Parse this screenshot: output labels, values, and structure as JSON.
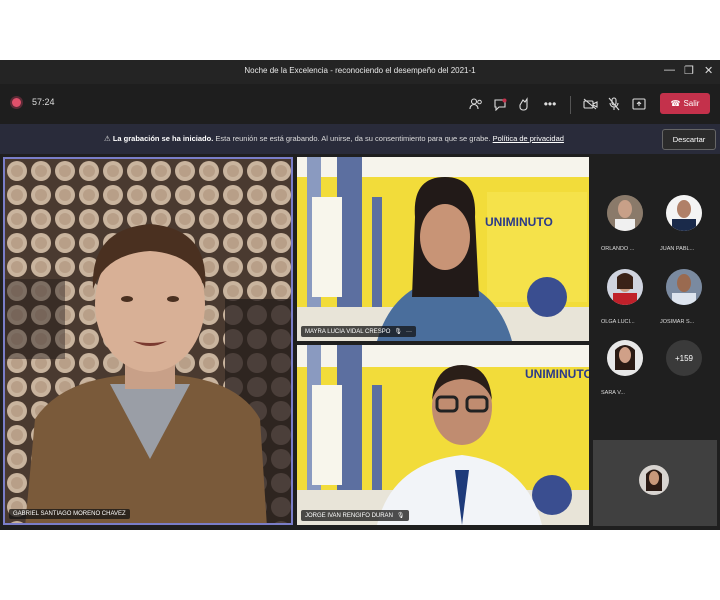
{
  "window": {
    "title": "Noche de la Excelencia - reconociendo el desempeño del 2021-1",
    "controls": {
      "minimize": "—",
      "restore": "❐",
      "close": "✕"
    }
  },
  "toolbar": {
    "timer": "57:24",
    "icons": [
      "people-icon",
      "chat-icon",
      "reactions-icon",
      "more-icon",
      "camera-off-icon",
      "mic-off-icon",
      "share-icon"
    ],
    "leave_label": "Salir"
  },
  "banner": {
    "bold": "La grabación se ha iniciado.",
    "text": "Esta reunión se está grabando. Al unirse, da su consentimiento para que se grabe.",
    "link": "Política de privacidad",
    "dismiss": "Descartar"
  },
  "tiles": [
    {
      "name": "GABRIEL SANTIAGO MORENO CHAVEZ"
    },
    {
      "name": "MAYRA LUCIA VIDAL CRESPO"
    },
    {
      "name": "JORGE IVAN RENGIFO DURAN"
    }
  ],
  "uniminuto_logo": "UNIMINUTO",
  "participants": [
    {
      "label": "ORLANDO ..."
    },
    {
      "label": "JUAN PABL..."
    },
    {
      "label": "OLGA LUCI..."
    },
    {
      "label": "JOSIMAR S..."
    },
    {
      "label": "SARA V..."
    }
  ],
  "more_participants": "+159",
  "colors": {
    "accent": "#6264a7",
    "leave": "#c4314b",
    "banner": "#292b3a"
  }
}
